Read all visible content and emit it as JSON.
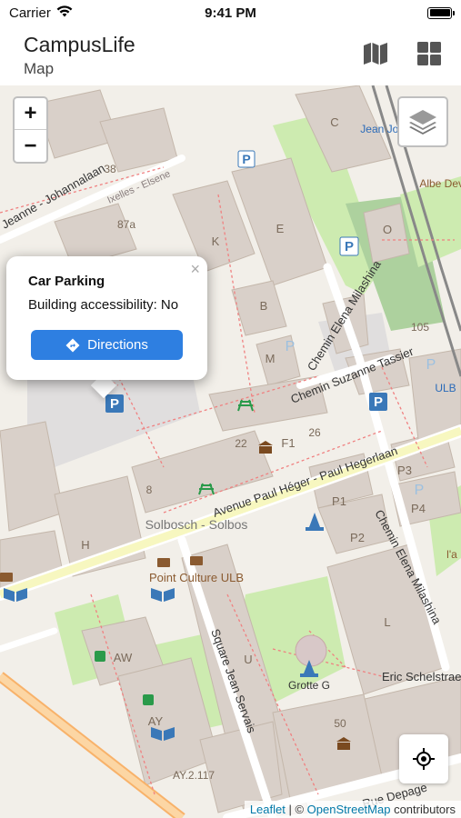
{
  "status": {
    "carrier": "Carrier",
    "time": "9:41 PM"
  },
  "header": {
    "title": "CampusLife",
    "subtitle": "Map"
  },
  "map": {
    "zoom_in": "+",
    "zoom_out": "−",
    "buildings": [
      "K",
      "E",
      "B",
      "M",
      "O",
      "C",
      "P1",
      "P2",
      "P3",
      "P4",
      "F1",
      "H",
      "AW",
      "AY",
      "U",
      "L"
    ],
    "numbers": [
      "38",
      "87a",
      "22",
      "26",
      "8",
      "105",
      "50"
    ],
    "streets": [
      "Jeanne - Johannalaan",
      "Ixelles - Elsene",
      "Chemin Elena Milashina",
      "Chemin Suzanne Tassier",
      "Avenue Paul Héger - Paul Hegerlaan",
      "Square Jean Servais",
      "Eric Schelstrae",
      "Rue Depage",
      "AY.2.117"
    ],
    "places": [
      "Solbosch - Solbos",
      "Point Culture ULB",
      "Grotte G",
      "ULB",
      "Jean Joha",
      "Albe Devez",
      "l'a"
    ],
    "attribution": {
      "leaflet": "Leaflet",
      "sep": " | © ",
      "osm": "OpenStreetMap",
      "tail": " contributors"
    }
  },
  "popup": {
    "title": "Car Parking",
    "text": "Building accessibility: No",
    "button": "Directions",
    "close": "×"
  }
}
